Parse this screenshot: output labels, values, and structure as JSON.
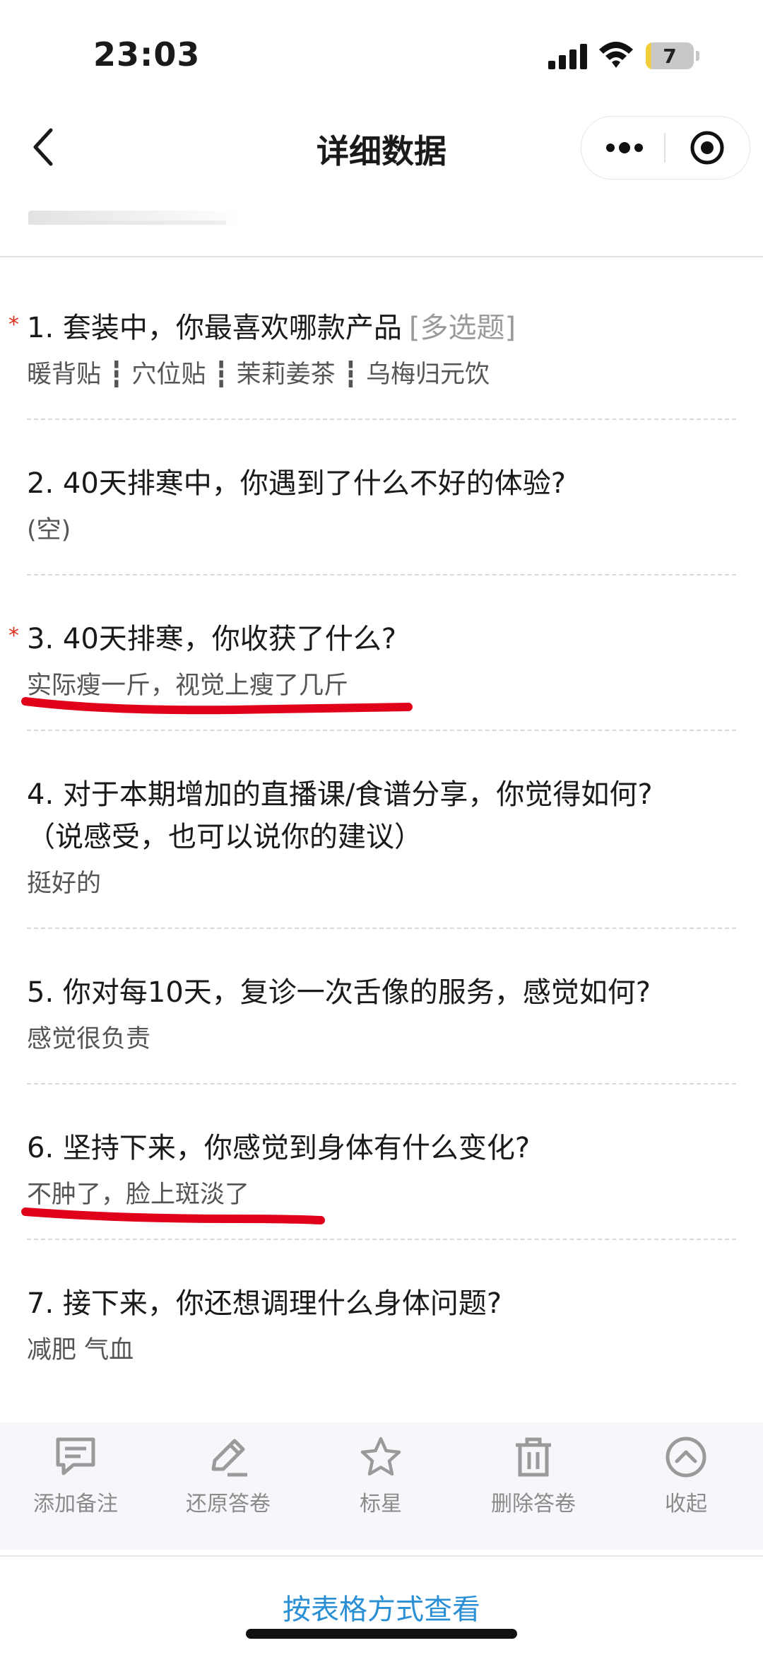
{
  "status_bar": {
    "time": "23:03",
    "battery_level": "7"
  },
  "nav": {
    "title": "详细数据"
  },
  "questions": [
    {
      "number": "1.",
      "title": "套装中，你最喜欢哪款产品",
      "tag": "[多选题]",
      "required": true,
      "answer": "暖背贴 ┇ 穴位贴 ┇ 茉莉姜茶 ┇ 乌梅归元饮"
    },
    {
      "number": "2.",
      "title": "40天排寒中，你遇到了什么不好的体验?",
      "required": false,
      "answer": "(空)"
    },
    {
      "number": "3.",
      "title": "40天排寒，你收获了什么?",
      "required": true,
      "answer": "实际瘦一斤，视觉上瘦了几斤"
    },
    {
      "number": "4.",
      "title": "对于本期增加的直播课/食谱分享，你觉得如何?",
      "title_line2": "（说感受，也可以说你的建议）",
      "required": false,
      "answer": "挺好的"
    },
    {
      "number": "5.",
      "title": "你对每10天，复诊一次舌像的服务，感觉如何?",
      "required": false,
      "answer": "感觉很负责"
    },
    {
      "number": "6.",
      "title": "坚持下来，你感觉到身体有什么变化?",
      "required": false,
      "answer": "不肿了，脸上斑淡了"
    },
    {
      "number": "7.",
      "title": "接下来，你还想调理什么身体问题?",
      "required": false,
      "answer": "减肥 气血"
    }
  ],
  "toolbar": {
    "add_note": "添加备注",
    "restore": "还原答卷",
    "star": "标星",
    "delete": "删除答卷",
    "collapse": "收起"
  },
  "footer": {
    "table_view": "按表格方式查看"
  },
  "colors": {
    "required": "#e0301e",
    "link": "#2b8fd6",
    "marker": "#e0001a"
  }
}
